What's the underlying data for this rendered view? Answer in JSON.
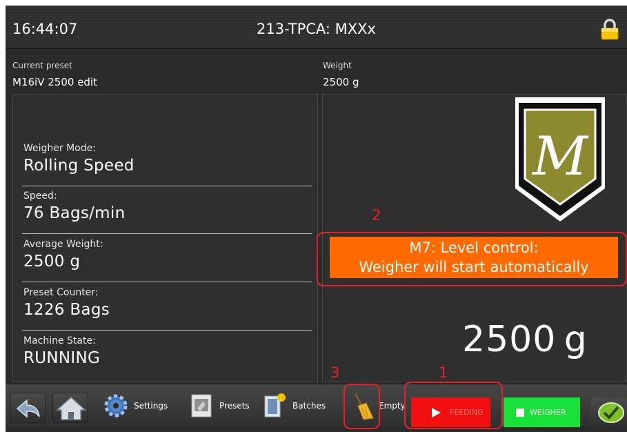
{
  "header": {
    "time": "16:44:07",
    "machine_title": "213-TPCA: MXXx",
    "lock_icon": "padlock-icon"
  },
  "info": {
    "current_preset_label": "Current preset",
    "current_preset_value": "M16iV 2500 edit",
    "weight_label": "Weight",
    "weight_value": "2500 g"
  },
  "status_fields": [
    {
      "label": "Weigher Mode:",
      "value": "Rolling Speed"
    },
    {
      "label": "Speed:",
      "value": "76 Bags/min"
    },
    {
      "label": "Average Weight:",
      "value": "2500 g"
    },
    {
      "label": "Preset Counter:",
      "value": "1226 Bags"
    },
    {
      "label": "Machine State:",
      "value": "RUNNING"
    }
  ],
  "alert": {
    "line1": "M7: Level control:",
    "line2": "Weigher will start automatically",
    "color": "#ff6a00"
  },
  "live_weight": "2500 g",
  "logo": {
    "letter": "M",
    "color": "#8a8a2e"
  },
  "annotations": [
    "1",
    "2",
    "3"
  ],
  "toolbar": {
    "back_icon": "back-arrow-icon",
    "home_icon": "home-icon",
    "settings_label": "Settings",
    "presets_label": "Presets",
    "batches_label": "Batches",
    "empty_label": "Empty",
    "feeding_label": "FEEDING",
    "weigher_label": "WEIGHER",
    "confirm_icon": "checkmark-icon",
    "feeding_color": "#f01010",
    "weigher_color": "#18e23a"
  }
}
